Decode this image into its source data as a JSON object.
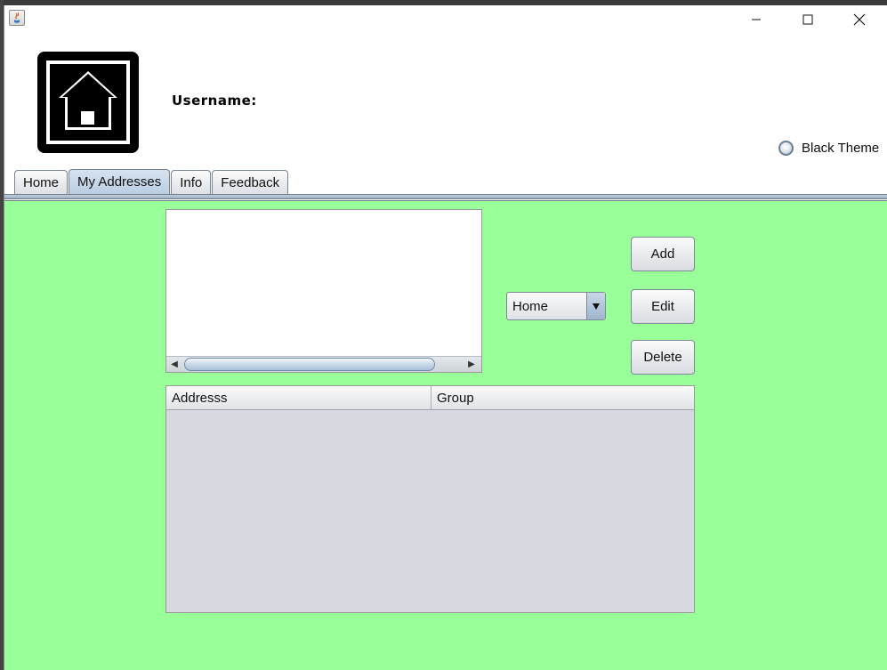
{
  "window": {
    "controls": {
      "minimize_icon": "minimize-icon",
      "maximize_icon": "maximize-icon",
      "close_icon": "close-icon"
    }
  },
  "header": {
    "logo_icon": "house-icon",
    "username_label": "Username:",
    "username_value": "",
    "theme_toggle": {
      "label": "Black Theme",
      "checked": false
    }
  },
  "tabs": [
    {
      "label": "Home",
      "active": false
    },
    {
      "label": "My Addresses",
      "active": true
    },
    {
      "label": "Info",
      "active": false
    },
    {
      "label": "Feedback",
      "active": false
    }
  ],
  "main": {
    "background_color": "#99ff99",
    "text_area_value": "",
    "group_select": {
      "selected": "Home"
    },
    "buttons": {
      "add": "Add",
      "edit": "Edit",
      "delete": "Delete"
    },
    "table": {
      "columns": [
        "Addresss",
        "Group"
      ],
      "rows": []
    }
  }
}
